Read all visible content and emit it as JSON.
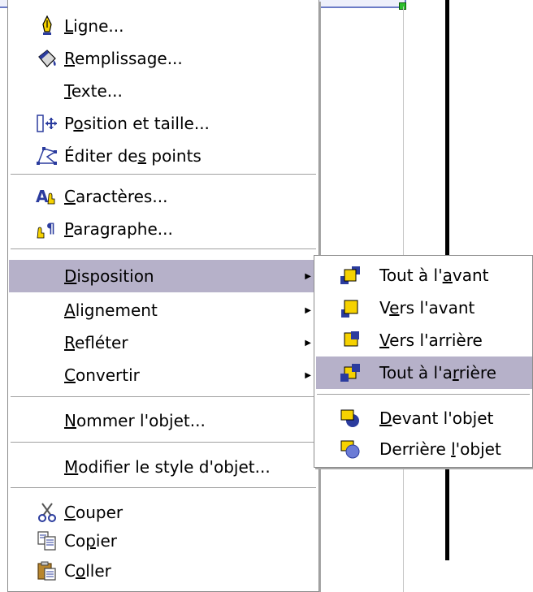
{
  "menu": {
    "items": [
      {
        "pre": "",
        "u": "L",
        "post": "igne...",
        "icon": "pen-icon"
      },
      {
        "pre": "",
        "u": "R",
        "post": "emplissage...",
        "icon": "paint-bucket-icon"
      },
      {
        "pre": "",
        "u": "T",
        "post": "exte...",
        "icon": ""
      },
      {
        "pre": "P",
        "u": "o",
        "post": "sition et taille...",
        "icon": "position-size-icon"
      },
      {
        "pre": "Éditer de",
        "u": "s",
        "post": " points",
        "icon": "edit-points-icon"
      },
      {
        "pre": "",
        "u": "C",
        "post": "aractères...",
        "icon": "characters-icon"
      },
      {
        "pre": "",
        "u": "P",
        "post": "aragraphe...",
        "icon": "paragraph-icon"
      },
      {
        "pre": "",
        "u": "D",
        "post": "isposition",
        "icon": "",
        "submenu": true
      },
      {
        "pre": "",
        "u": "A",
        "post": "lignement",
        "icon": "",
        "submenu": true
      },
      {
        "pre": "",
        "u": "R",
        "post": "efléter",
        "icon": "",
        "submenu": true
      },
      {
        "pre": "",
        "u": "C",
        "post": "onvertir",
        "icon": "",
        "submenu": true
      },
      {
        "pre": "",
        "u": "N",
        "post": "ommer l'objet...",
        "icon": ""
      },
      {
        "pre": "",
        "u": "M",
        "post": "odifier le style d'objet...",
        "icon": ""
      },
      {
        "pre": "",
        "u": "C",
        "post": "ouper",
        "icon": "scissors-icon"
      },
      {
        "pre": "Co",
        "u": "p",
        "post": "ier",
        "icon": "copy-icon"
      },
      {
        "pre": "C",
        "u": "o",
        "post": "ller",
        "icon": "paste-icon"
      }
    ],
    "highlighted_label": "Disposition"
  },
  "submenu": {
    "items": [
      {
        "pre": "Tout à l'",
        "u": "a",
        "post": "vant",
        "icon": "bring-to-front-icon"
      },
      {
        "pre": "V",
        "u": "e",
        "post": "rs l'avant",
        "icon": "bring-forward-icon"
      },
      {
        "pre": "",
        "u": "V",
        "post": "ers l'arrière",
        "icon": "send-backward-icon"
      },
      {
        "pre": "Tout à l'a",
        "u": "r",
        "post": "rière",
        "icon": "send-to-back-icon"
      },
      {
        "pre": "",
        "u": "D",
        "post": "evant l'objet",
        "icon": "in-front-of-object-icon"
      },
      {
        "pre": "Derrière ",
        "u": "l",
        "post": "'objet",
        "icon": "behind-object-icon"
      }
    ],
    "highlighted_label": "Tout à l'arrière"
  },
  "colors": {
    "highlight": "#b6b1c9",
    "menu_bg": "#ffffff",
    "border": "#8c8c8c",
    "icon_yellow": "#f6d200",
    "icon_blue": "#2b3c9e"
  }
}
